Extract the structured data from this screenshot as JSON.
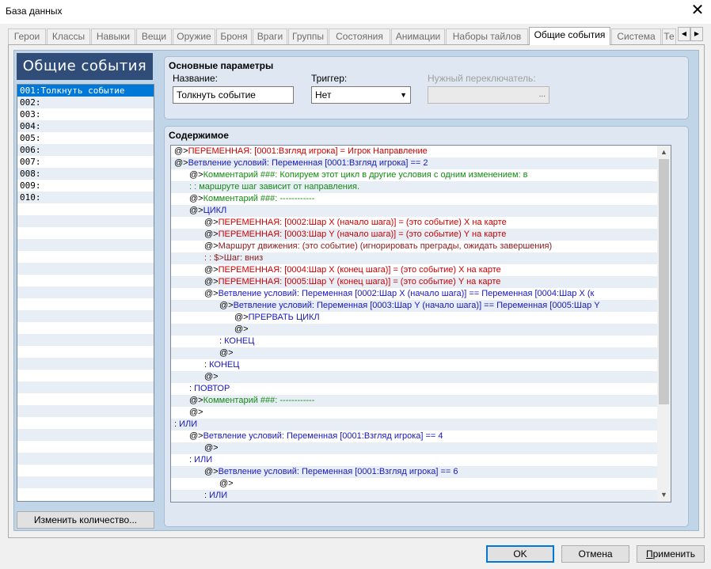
{
  "window": {
    "title": "База данных",
    "close_icon": "close-icon"
  },
  "tabs": [
    {
      "label": "Герои",
      "active": false
    },
    {
      "label": "Классы",
      "active": false
    },
    {
      "label": "Навыки",
      "active": false
    },
    {
      "label": "Вещи",
      "active": false
    },
    {
      "label": "Оружие",
      "active": false
    },
    {
      "label": "Броня",
      "active": false
    },
    {
      "label": "Враги",
      "active": false
    },
    {
      "label": "Группы",
      "active": false
    },
    {
      "label": "Состояния",
      "active": false
    },
    {
      "label": "Анимации",
      "active": false
    },
    {
      "label": "Наборы тайлов",
      "active": false
    },
    {
      "label": "Общие события",
      "active": true
    },
    {
      "label": "Система",
      "active": false
    },
    {
      "label": "Те",
      "active": false
    }
  ],
  "sidebar": {
    "header": "Общие события",
    "items": [
      "001:Толкнуть событие",
      "002:",
      "003:",
      "004:",
      "005:",
      "006:",
      "007:",
      "008:",
      "009:",
      "010:"
    ],
    "selected_index": 0,
    "change_count_button": "Изменить количество..."
  },
  "params": {
    "group_title": "Основные параметры",
    "name_label": "Название:",
    "name_value": "Толкнуть событие",
    "trigger_label": "Триггер:",
    "trigger_value": "Нет",
    "switch_label": "Нужный переключатель:",
    "switch_value": "",
    "switch_button": "..."
  },
  "content": {
    "group_title": "Содержимое",
    "lines": [
      {
        "indent": 0,
        "parts": [
          [
            "k",
            "@>"
          ],
          [
            "red",
            "ПЕРЕМЕННАЯ: [0001:Взгляд игрока] = Игрок Направление"
          ]
        ]
      },
      {
        "indent": 0,
        "parts": [
          [
            "k",
            "@>"
          ],
          [
            "blue",
            "Ветвление условий: Переменная [0001:Взгляд игрока] == 2"
          ]
        ]
      },
      {
        "indent": 1,
        "parts": [
          [
            "k",
            "@>"
          ],
          [
            "green",
            "Комментарий ###: Копируем этот цикл в другие условия с одним изменением: в"
          ]
        ]
      },
      {
        "indent": 1,
        "parts": [
          [
            "green",
            " :                            : маршруте шаг зависит от направления."
          ]
        ]
      },
      {
        "indent": 1,
        "parts": [
          [
            "k",
            "@>"
          ],
          [
            "green",
            "Комментарий ###: ------------"
          ]
        ]
      },
      {
        "indent": 1,
        "parts": [
          [
            "k",
            "@>"
          ],
          [
            "blue",
            "ЦИКЛ"
          ]
        ]
      },
      {
        "indent": 2,
        "parts": [
          [
            "k",
            "@>"
          ],
          [
            "red",
            "ПЕРЕМЕННАЯ: [0002:Шар X (начало шага)] = (это событие) X на карте"
          ]
        ]
      },
      {
        "indent": 2,
        "parts": [
          [
            "k",
            "@>"
          ],
          [
            "red",
            "ПЕРЕМЕННАЯ: [0003:Шар Y (начало шага)] = (это событие) Y на карте"
          ]
        ]
      },
      {
        "indent": 2,
        "parts": [
          [
            "k",
            "@>"
          ],
          [
            "dred",
            "Маршрут движения: (это событие) (игнорировать преграды, ожидать завершения)"
          ]
        ]
      },
      {
        "indent": 2,
        "parts": [
          [
            "dred",
            " :                            : $>Шаг: вниз"
          ]
        ]
      },
      {
        "indent": 2,
        "parts": [
          [
            "k",
            "@>"
          ],
          [
            "red",
            "ПЕРЕМЕННАЯ: [0004:Шар X (конец шага)] = (это событие) X на карте"
          ]
        ]
      },
      {
        "indent": 2,
        "parts": [
          [
            "k",
            "@>"
          ],
          [
            "red",
            "ПЕРЕМЕННАЯ: [0005:Шар Y (конец шага)] = (это событие) Y на карте"
          ]
        ]
      },
      {
        "indent": 2,
        "parts": [
          [
            "k",
            "@>"
          ],
          [
            "blue",
            "Ветвление условий: Переменная [0002:Шар X (начало шага)] == Переменная [0004:Шар X (к"
          ]
        ]
      },
      {
        "indent": 3,
        "parts": [
          [
            "k",
            "@>"
          ],
          [
            "blue",
            "Ветвление условий: Переменная [0003:Шар Y (начало шага)] == Переменная [0005:Шар Y"
          ]
        ]
      },
      {
        "indent": 4,
        "parts": [
          [
            "k",
            "@>"
          ],
          [
            "blue",
            "ПРЕРВАТЬ ЦИКЛ"
          ]
        ]
      },
      {
        "indent": 4,
        "parts": [
          [
            "k",
            "@>"
          ]
        ]
      },
      {
        "indent": 3,
        "parts": [
          [
            "k",
            " :  "
          ],
          [
            "blue",
            "КОНЕЦ"
          ]
        ]
      },
      {
        "indent": 3,
        "parts": [
          [
            "k",
            "@>"
          ]
        ]
      },
      {
        "indent": 2,
        "parts": [
          [
            "k",
            " :  "
          ],
          [
            "blue",
            "КОНЕЦ"
          ]
        ]
      },
      {
        "indent": 2,
        "parts": [
          [
            "k",
            "@>"
          ]
        ]
      },
      {
        "indent": 1,
        "parts": [
          [
            "k",
            " :  "
          ],
          [
            "blue",
            "ПОВТОР"
          ]
        ]
      },
      {
        "indent": 1,
        "parts": [
          [
            "k",
            "@>"
          ],
          [
            "green",
            "Комментарий ###: ------------"
          ]
        ]
      },
      {
        "indent": 1,
        "parts": [
          [
            "k",
            "@>"
          ]
        ]
      },
      {
        "indent": 0,
        "parts": [
          [
            "k",
            " :  "
          ],
          [
            "blue",
            "ИЛИ"
          ]
        ]
      },
      {
        "indent": 1,
        "parts": [
          [
            "k",
            "@>"
          ],
          [
            "blue",
            "Ветвление условий: Переменная [0001:Взгляд игрока] == 4"
          ]
        ]
      },
      {
        "indent": 2,
        "parts": [
          [
            "k",
            "@>"
          ]
        ]
      },
      {
        "indent": 1,
        "parts": [
          [
            "k",
            " :  "
          ],
          [
            "blue",
            "ИЛИ"
          ]
        ]
      },
      {
        "indent": 2,
        "parts": [
          [
            "k",
            "@>"
          ],
          [
            "blue",
            "Ветвление условий: Переменная [0001:Взгляд игрока] == 6"
          ]
        ]
      },
      {
        "indent": 3,
        "parts": [
          [
            "k",
            "@>"
          ]
        ]
      },
      {
        "indent": 2,
        "parts": [
          [
            "k",
            " :  "
          ],
          [
            "blue",
            "ИЛИ"
          ]
        ]
      }
    ]
  },
  "footer": {
    "ok": "OK",
    "cancel": "Отмена",
    "apply_u": "П",
    "apply_rest": "рименить"
  }
}
